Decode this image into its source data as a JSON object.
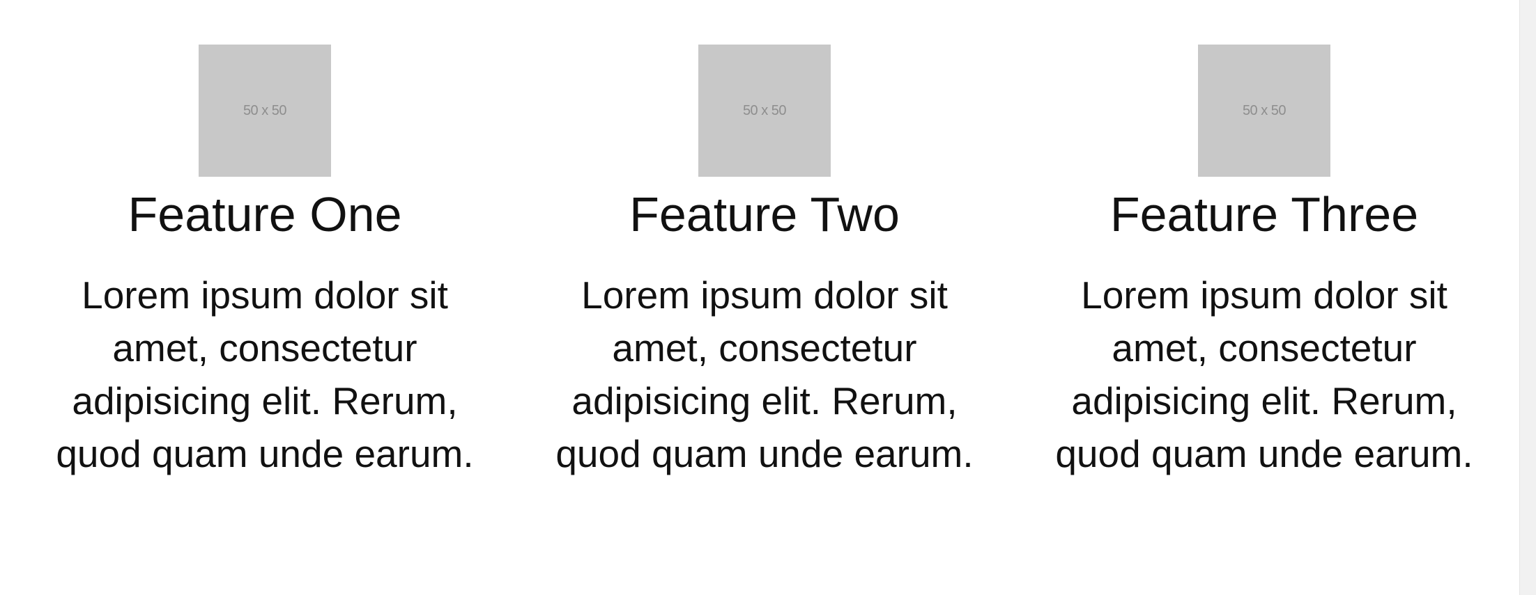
{
  "features": [
    {
      "image_label": "50 x 50",
      "title": "Feature One",
      "text": "Lorem ipsum dolor sit amet, consectetur adipisicing elit. Rerum, quod quam unde earum."
    },
    {
      "image_label": "50 x 50",
      "title": "Feature Two",
      "text": "Lorem ipsum dolor sit amet, consectetur adipisicing elit. Rerum, quod quam unde earum."
    },
    {
      "image_label": "50 x 50",
      "title": "Feature Three",
      "text": "Lorem ipsum dolor sit amet, consectetur adipisicing elit. Rerum, quod quam unde earum."
    }
  ],
  "colors": {
    "placeholder_bg": "#c8c8c8",
    "placeholder_text": "#8e8e8e",
    "text": "#111111",
    "background": "#ffffff"
  }
}
